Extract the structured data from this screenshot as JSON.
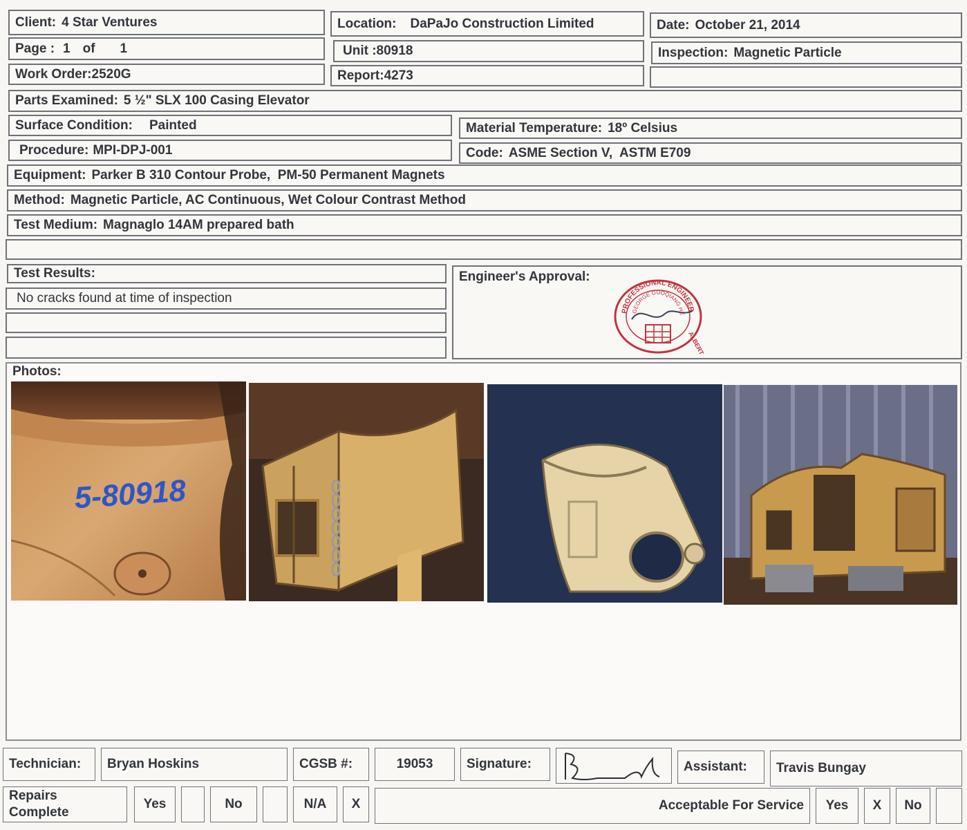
{
  "header": {
    "client_label": "Client:",
    "client_value": "4 Star Ventures",
    "location_label": "Location:",
    "location_value": "DaPaJo Construction Limited",
    "date_label": "Date:",
    "date_value": "October 21, 2014",
    "page_label": "Page :",
    "page_number": "1",
    "page_of": "of",
    "page_total": "1",
    "unit_label": "Unit :",
    "unit_value": "80918",
    "inspection_label": "Inspection:",
    "inspection_value": "Magnetic Particle",
    "work_order_label": "Work Order:",
    "work_order_value": "2520G",
    "report_label": "Report:",
    "report_value": "4273"
  },
  "details": {
    "parts_label": "Parts Examined:",
    "parts_value": "5 ½\" SLX 100 Casing Elevator",
    "surface_label": "Surface Condition:",
    "surface_value": "Painted",
    "material_label": "Material Temperature:",
    "material_value": "18º Celsius",
    "procedure_label": "Procedure:",
    "procedure_value": "MPI-DPJ-001",
    "code_label": "Code:",
    "code_value": "ASME Section V,  ASTM E709",
    "equipment_label": "Equipment:",
    "equipment_value": "Parker B 310 Contour Probe,  PM-50 Permanent Magnets",
    "method_label": "Method:",
    "method_value": "Magnetic Particle, AC Continuous, Wet Colour Contrast Method",
    "medium_label": "Test Medium:",
    "medium_value": "Magnaglo 14AM prepared bath"
  },
  "results": {
    "label": "Test Results:",
    "line1": "No cracks found at time of inspection",
    "line2": "",
    "line3": ""
  },
  "approval": {
    "label": "Engineer's Approval:",
    "stamp_text_top": "PROFESSIONAL ENGINEER",
    "stamp_text_name": "GEORGE GUOQIANG HE",
    "stamp_text_province": "ALBERTA"
  },
  "photos": {
    "label": "Photos:",
    "marking_text": "5-80918"
  },
  "footer": {
    "technician_label": "Technician:",
    "technician_value": "Bryan Hoskins",
    "cgsb_label": "CGSB #:",
    "cgsb_value": "19053",
    "signature_label": "Signature:",
    "assistant_label": "Assistant:",
    "assistant_value": "Travis Bungay",
    "repairs_label_1": "Repairs",
    "repairs_label_2": "Complete",
    "yes_label": "Yes",
    "yes_mark": "",
    "no_label": "No",
    "no_mark": "",
    "na_label": "N/A",
    "na_mark": "X",
    "acceptable_label": "Acceptable For Service",
    "acc_yes_label": "Yes",
    "acc_yes_mark": "X",
    "acc_no_label": "No",
    "acc_no_mark": ""
  },
  "colors": {
    "border": "#6f7178",
    "stamp": "#c0323f",
    "marking": "#2f55c8"
  }
}
